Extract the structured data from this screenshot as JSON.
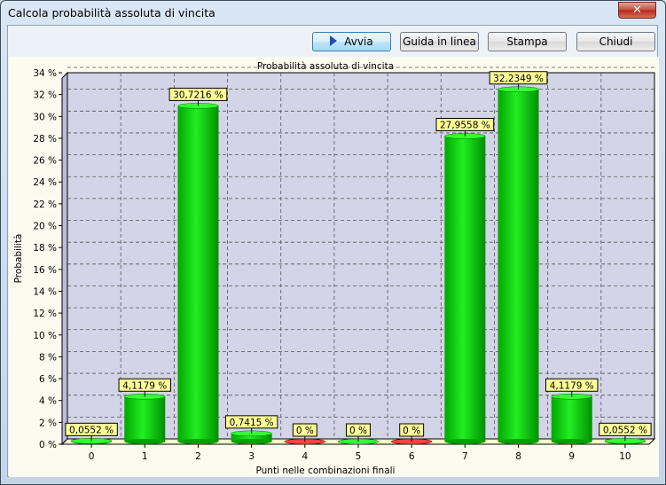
{
  "window": {
    "title": "Calcola probabilità assoluta di vincita",
    "close_symbol": "✕"
  },
  "toolbar": {
    "run_label": "Avvia",
    "help_label": "Guida in linea",
    "print_label": "Stampa",
    "close_label": "Chiudi"
  },
  "colors": {
    "bar_green": "#00d000",
    "bar_red": "#cc0000",
    "plot_bg": "#d4d4e8",
    "label_bg": "#ffff99"
  },
  "chart_data": {
    "type": "bar",
    "title": "Probabilità assoluta di vincita",
    "xlabel": "Punti nelle combinazioni finali",
    "ylabel": "Probabilità",
    "categories": [
      "0",
      "1",
      "2",
      "3",
      "4",
      "5",
      "6",
      "7",
      "8",
      "9",
      "10"
    ],
    "values": [
      0.0552,
      4.1179,
      30.7216,
      0.7415,
      0,
      0,
      0,
      27.9558,
      32.2349,
      4.1179,
      0.0552
    ],
    "data_labels": [
      "0,0552 %",
      "4,1179 %",
      "30,7216 %",
      "0,7415 %",
      "0 %",
      "0 %",
      "0 %",
      "27,9558 %",
      "32,2349 %",
      "4,1179 %",
      "0,0552 %"
    ],
    "bar_colors": [
      "green",
      "green",
      "green",
      "green",
      "red",
      "green",
      "red",
      "green",
      "green",
      "green",
      "green"
    ],
    "ylim": [
      0,
      34
    ],
    "yticks": [
      0,
      2,
      4,
      6,
      8,
      10,
      12,
      14,
      16,
      18,
      20,
      22,
      24,
      26,
      28,
      30,
      32,
      34
    ],
    "ytick_labels": [
      "0 %",
      "2 %",
      "4 %",
      "6 %",
      "8 %",
      "10 %",
      "12 %",
      "14 %",
      "16 %",
      "18 %",
      "20 %",
      "22 %",
      "24 %",
      "26 %",
      "28 %",
      "30 %",
      "32 %",
      "34 %"
    ],
    "grid": true
  }
}
